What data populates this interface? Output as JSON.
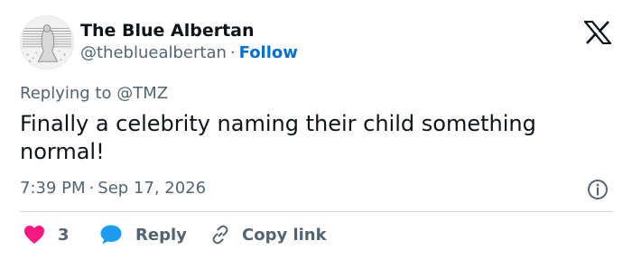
{
  "author": {
    "name": "The Blue Albertan",
    "handle": "@thebluealbertan",
    "separator": "·",
    "follow_label": "Follow"
  },
  "reply_context": {
    "prefix": "Replying to",
    "mention": "@TMZ"
  },
  "tweet": {
    "text": "Finally a celebrity naming their child something normal!",
    "time": "7:39 PM",
    "separator": "·",
    "date": "Sep 17, 2026"
  },
  "actions": {
    "like_count": "3",
    "reply_label": "Reply",
    "copy_label": "Copy link"
  },
  "icons": {
    "brand": "x-logo-icon",
    "info": "info-icon",
    "like": "heart-icon",
    "reply": "speech-bubble-icon",
    "copy": "link-icon"
  },
  "colors": {
    "text_primary": "#0f1419",
    "text_secondary": "#536471",
    "follow": "#006fd6",
    "like": "#f91880",
    "reply": "#1d9bf0",
    "divider": "#cfd9de"
  }
}
